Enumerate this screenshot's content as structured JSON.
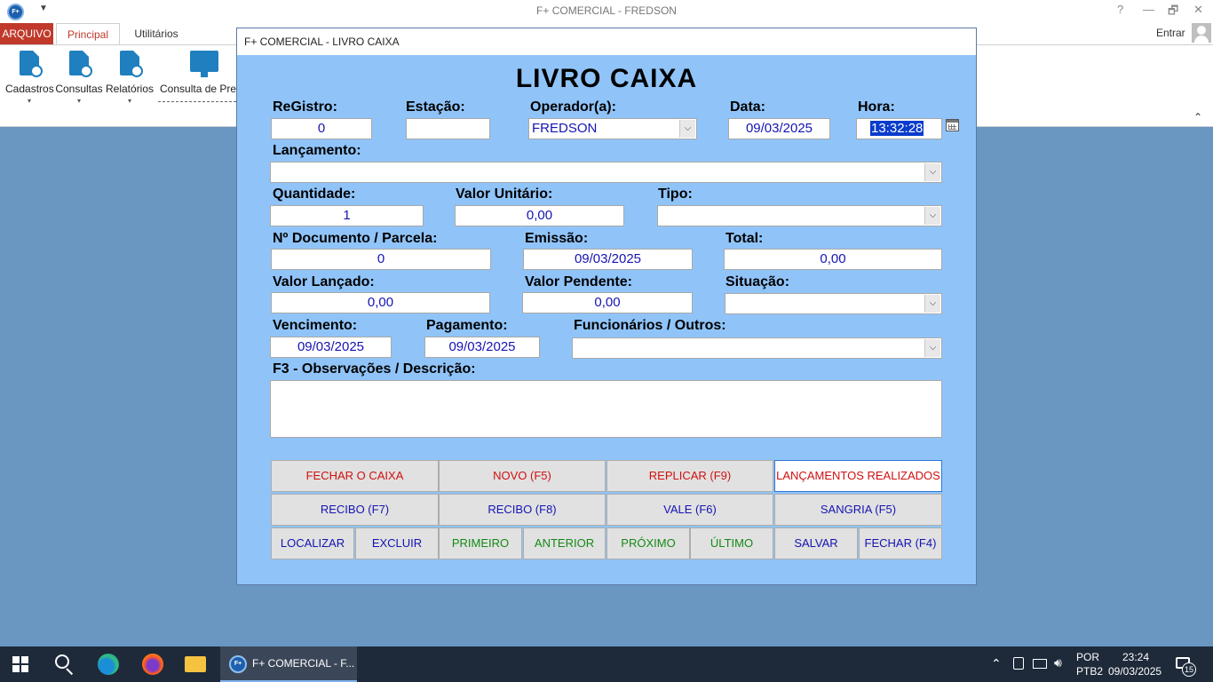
{
  "window": {
    "title": "F+ COMERCIAL - FREDSON",
    "app_icon_text": "F+",
    "qa_arrow": "▼",
    "help": "?",
    "minimize": "—",
    "restore": "🗗",
    "close": "✕"
  },
  "ribbon": {
    "tabs": {
      "arquivo": "ARQUIVO",
      "principal": "Principal",
      "utilitarios": "Utilitários"
    },
    "signin": "Entrar",
    "buttons": {
      "cadastros": "Cadastros",
      "consultas": "Consultas",
      "relatorios": "Relatórios",
      "consulta_preco": "Consulta de Preç"
    },
    "caret": "▾",
    "collapse": "⌃"
  },
  "dialog": {
    "title": "F+ COMERCIAL - LIVRO CAIXA",
    "heading": "LIVRO CAIXA",
    "labels": {
      "registro": "ReGistro:",
      "estacao": "Estação:",
      "operador": "Operador(a):",
      "data": "Data:",
      "hora": "Hora:",
      "lancamento": "Lançamento:",
      "quantidade": "Quantidade:",
      "valor_unitario": "Valor Unitário:",
      "tipo": "Tipo:",
      "documento": "Nº Documento / Parcela:",
      "emissao": "Emissão:",
      "total": "Total:",
      "valor_lancado": "Valor Lançado:",
      "valor_pendente": "Valor Pendente:",
      "situacao": "Situação:",
      "vencimento": "Vencimento:",
      "pagamento": "Pagamento:",
      "funcionarios": "Funcionários / Outros:",
      "observacoes": "F3 - Observações / Descrição:"
    },
    "values": {
      "registro": "0",
      "estacao": "",
      "operador": "FREDSON",
      "data": "09/03/2025",
      "hora": "13:32:28",
      "lancamento": "",
      "quantidade": "1",
      "valor_unitario": "0,00",
      "tipo": "",
      "documento": "0",
      "emissao": "09/03/2025",
      "total": "0,00",
      "valor_lancado": "0,00",
      "valor_pendente": "0,00",
      "situacao": "",
      "vencimento": "09/03/2025",
      "pagamento": "09/03/2025",
      "funcionarios": "",
      "observacoes": ""
    },
    "dropdown_arrow": "⌵",
    "buttons": {
      "fechar_caixa": "FECHAR O CAIXA",
      "novo": "NOVO (F5)",
      "replicar": "REPLICAR (F9)",
      "lancamentos": "LANÇAMENTOS REALIZADOS",
      "recibo_f7": "RECIBO (F7)",
      "recibo_f8": "RECIBO (F8)",
      "vale": "VALE (F6)",
      "sangria": "SANGRIA (F5)",
      "localizar": "LOCALIZAR",
      "excluir": "EXCLUIR",
      "primeiro": "PRIMEIRO",
      "anterior": "ANTERIOR",
      "proximo": "PRÓXIMO",
      "ultimo": "ÚLTIMO",
      "salvar": "SALVAR",
      "fechar": "FECHAR (F4)"
    }
  },
  "taskbar": {
    "active_app": "F+ COMERCIAL - F...",
    "active_app_icon_text": "F+",
    "tray_chevron": "⌃",
    "lang_top": "POR",
    "lang_bottom": "PTB2",
    "time": "23:24",
    "date": "09/03/2025",
    "notifications": "15"
  },
  "colors": {
    "accent": "#c0392b",
    "dialog_bg": "#90c4f9",
    "desktop": "#6a96c2",
    "field_text": "#1414b4"
  }
}
